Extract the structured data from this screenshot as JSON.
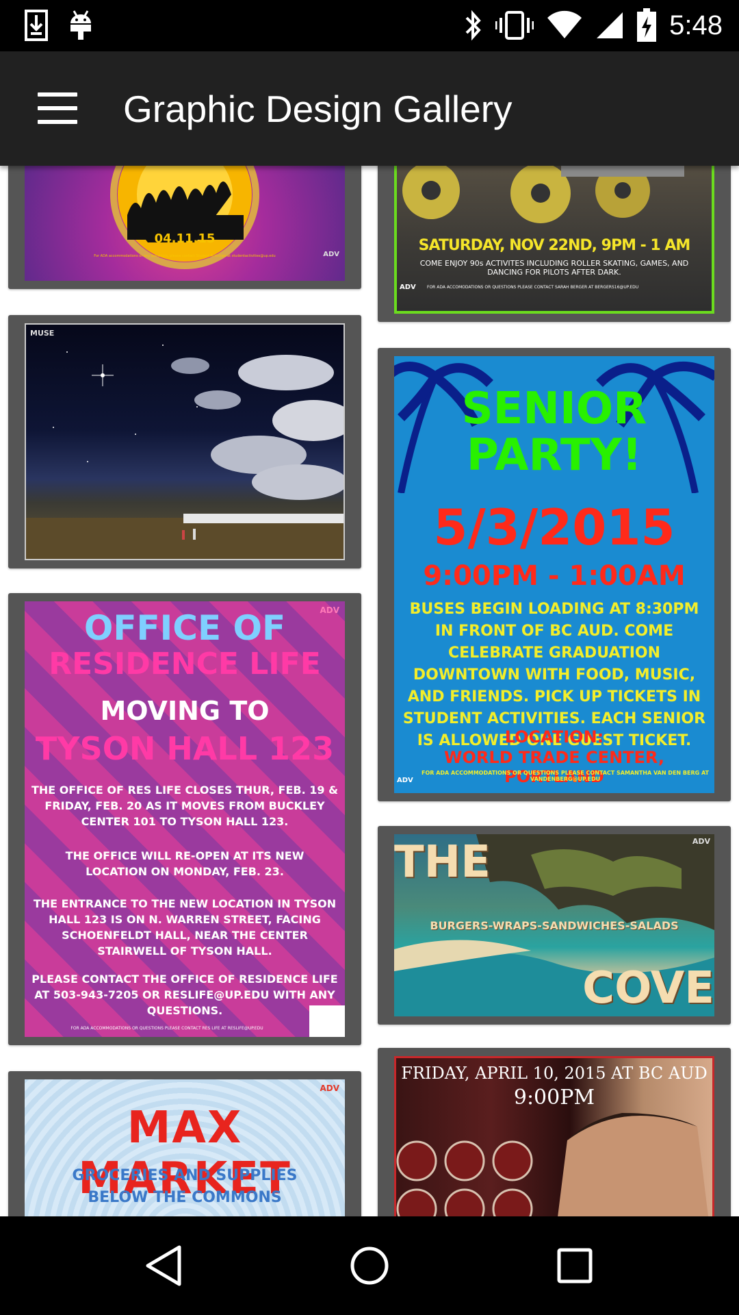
{
  "status_bar": {
    "time": "5:48",
    "left_icons": [
      "download-icon",
      "android-icon"
    ],
    "right_icons": [
      "bluetooth-icon",
      "vibrate-icon",
      "wifi-icon",
      "signal-icon",
      "battery-charging-icon"
    ]
  },
  "app_bar": {
    "title": "Graphic Design Gallery",
    "menu_icon": "hamburger-menu-icon"
  },
  "posters": {
    "roller": {
      "headline": "SATURDAY, NOV 22ND, 9PM - 1 AM",
      "body": "COME ENJOY 90s ACTIVITES INCLUDING ROLLER SKATING, GAMES, AND DANCING FOR PILOTS AFTER DARK.",
      "footer": "FOR ADA ACCOMODATIONS OR QUESTIONS PLEASE CONTACT SARAH BERGER AT BERGERS16@UP.EDU",
      "badge": "ADV"
    },
    "party": {
      "date": "04.11.15",
      "footer": "For ADA accommodations or any questions, please contact Student Activities at studentactivities@up.edu",
      "badge": "ADV"
    },
    "muse": {
      "label": "MUSE"
    },
    "senior": {
      "title_line1": "SENIOR",
      "title_line2": "PARTY!",
      "date": "5/3/2015",
      "time": "9:00PM - 1:00AM",
      "body": "BUSES BEGIN LOADING AT 8:30PM IN FRONT OF BC AUD. COME CELEBRATE GRADUATION DOWNTOWN WITH FOOD, MUSIC, AND FRIENDS. PICK UP TICKETS IN STUDENT ACTIVITIES. EACH SENIOR IS ALLOWED ONE GUEST TICKET.",
      "location_label": "LOCATION:",
      "location": "WORLD TRADE CENTER, PORTLAND",
      "footer": "FOR ADA ACCOMMODATIONS OR QUESTIONS PLEASE CONTACT SAMANTHA VAN DEN BERG AT VANDENBERG@UP.EDU",
      "badge": "ADV"
    },
    "residence": {
      "line1": "OFFICE OF",
      "line2": "RESIDENCE LIFE",
      "line3": "MOVING TO",
      "line4": "TYSON HALL 123",
      "para1": "THE OFFICE OF RES LIFE CLOSES THUR, FEB. 19 & FRIDAY, FEB. 20 AS IT MOVES FROM BUCKLEY CENTER 101 TO TYSON HALL 123.",
      "para2": "THE OFFICE WILL RE-OPEN AT ITS NEW LOCATION ON MONDAY, FEB. 23.",
      "para3": "THE ENTRANCE TO THE NEW LOCATION IN TYSON HALL 123 IS ON N. WARREN STREET, FACING SCHOENFELDT HALL, NEAR THE CENTER STAIRWELL OF TYSON HALL.",
      "para4": "PLEASE CONTACT THE OFFICE OF RESIDENCE LIFE AT 503-943-7205 OR RESLIFE@UP.EDU WITH ANY QUESTIONS.",
      "footer": "FOR ADA ACCOMMODATIONS OR QUESTIONS PLEASE CONTACT RES LIFE AT RESLIFE@UP.EDU",
      "badge": "ADV"
    },
    "cove": {
      "title_top": "THE",
      "menu": "BURGERS-WRAPS-SANDWICHES-SALADS",
      "title_bottom": "COVE",
      "badge": "ADV"
    },
    "max": {
      "title": "MAX MARKET",
      "subtitle_line1": "GROCERIES AND SUPPLIES",
      "subtitle_line2": "BELOW THE COMMONS",
      "badge": "ADV"
    },
    "movie": {
      "date_line": "FRIDAY, APRIL 10, 2015 AT BC AUD",
      "time": "9:00PM"
    }
  },
  "nav_bar": {
    "back": "back-triangle-icon",
    "home": "home-circle-icon",
    "recents": "recents-square-icon"
  }
}
